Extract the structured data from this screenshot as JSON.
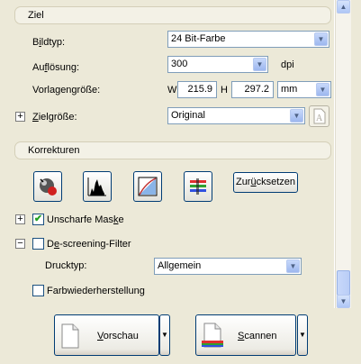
{
  "ziel": {
    "header": "Ziel",
    "bildtyp": {
      "label_pre": "B",
      "label_ul": "i",
      "label_post": "ldtyp:",
      "value": "24 Bit-Farbe"
    },
    "aufloesung": {
      "label_pre": "Au",
      "label_ul": "f",
      "label_post": "lösung:",
      "value": "300",
      "unit": "dpi"
    },
    "vorlagengroesse": {
      "label": "Vorlagengröße:",
      "w_label": "W",
      "w_value": "215.9",
      "h_label": "H",
      "h_value": "297.2",
      "unit": "mm"
    },
    "zielgroesse": {
      "expander": "+",
      "label_ul": "Z",
      "label_post": "ielgröße:",
      "value": "Original"
    }
  },
  "korrekturen": {
    "header": "Korrekturen",
    "tools": [
      {
        "name": "auto-exposure-icon"
      },
      {
        "name": "histogram-icon"
      },
      {
        "name": "tone-curve-icon"
      },
      {
        "name": "color-palette-icon"
      }
    ],
    "reset_pre": "Zur",
    "reset_ul": "ü",
    "reset_post": "cksetzen",
    "unscharfe_maske": {
      "expander": "+",
      "checked": true,
      "label_pre": "Unscharfe Mas",
      "label_ul": "k",
      "label_post": "e"
    },
    "descreening": {
      "expander": "−",
      "checked": false,
      "label_pre": "D",
      "label_ul": "e",
      "label_post": "-screening-Filter"
    },
    "drucktyp": {
      "label": "Drucktyp:",
      "value": "Allgemein"
    },
    "farbwiederherstellung": {
      "checked": false,
      "label": "Farbwiederherstellung"
    }
  },
  "footer": {
    "preview_ul": "V",
    "preview_post": "orschau",
    "scan_ul": "S",
    "scan_post": "cannen"
  },
  "colors": {
    "accent": "#003c74",
    "field_border": "#7f9db9",
    "checkmark": "#21a121"
  }
}
